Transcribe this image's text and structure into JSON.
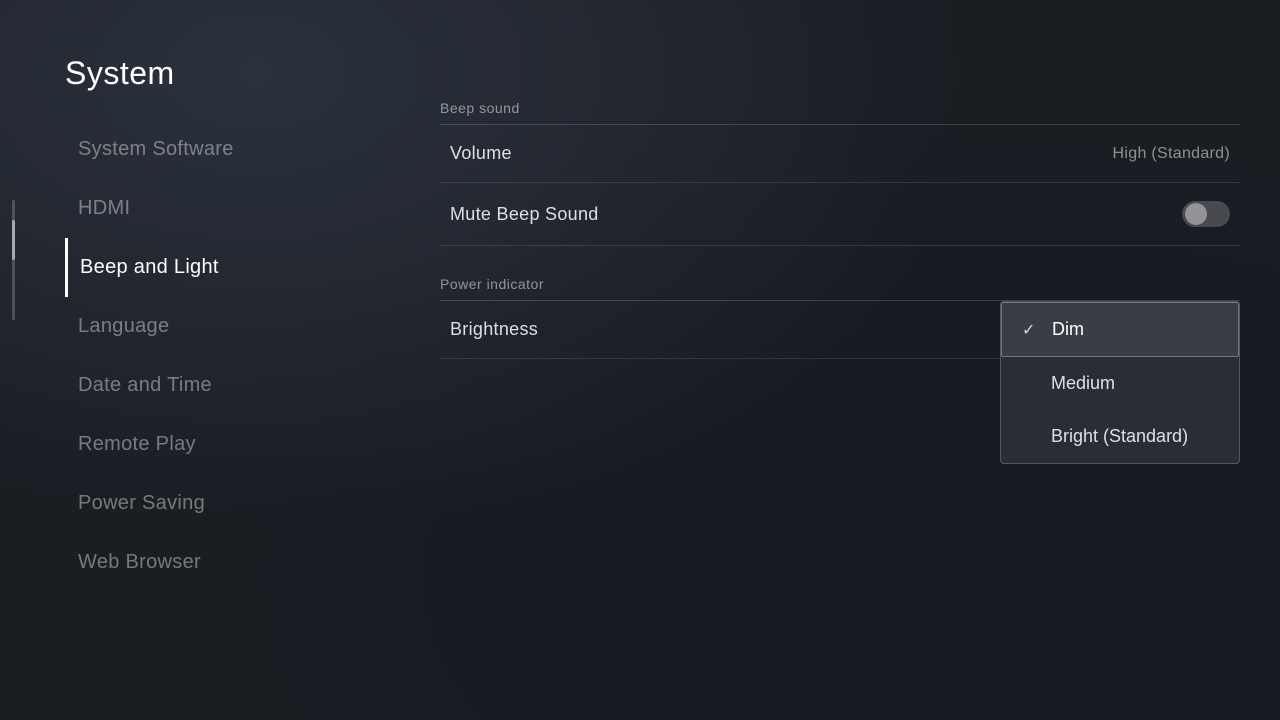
{
  "page": {
    "title": "System"
  },
  "sidebar": {
    "items": [
      {
        "id": "system-software",
        "label": "System Software",
        "active": false
      },
      {
        "id": "hdmi",
        "label": "HDMI",
        "active": false
      },
      {
        "id": "beep-and-light",
        "label": "Beep and Light",
        "active": true
      },
      {
        "id": "language",
        "label": "Language",
        "active": false
      },
      {
        "id": "date-and-time",
        "label": "Date and Time",
        "active": false
      },
      {
        "id": "remote-play",
        "label": "Remote Play",
        "active": false
      },
      {
        "id": "power-saving",
        "label": "Power Saving",
        "active": false
      },
      {
        "id": "web-browser",
        "label": "Web Browser",
        "active": false
      }
    ]
  },
  "content": {
    "beep_sound": {
      "section_label": "Beep sound",
      "volume_label": "Volume",
      "volume_value": "High (Standard)",
      "mute_label": "Mute Beep Sound",
      "mute_enabled": false
    },
    "power_indicator": {
      "section_label": "Power indicator",
      "brightness_label": "Brightness",
      "dropdown": {
        "options": [
          {
            "id": "dim",
            "label": "Dim",
            "selected": true
          },
          {
            "id": "medium",
            "label": "Medium",
            "selected": false
          },
          {
            "id": "bright",
            "label": "Bright (Standard)",
            "selected": false
          }
        ]
      }
    }
  },
  "icons": {
    "check": "✓"
  }
}
